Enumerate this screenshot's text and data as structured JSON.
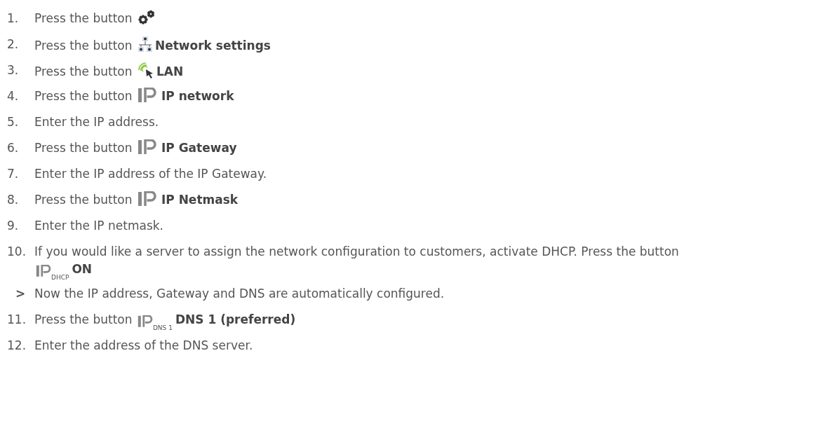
{
  "steps": [
    {
      "kind": "press",
      "number": "1.",
      "text": "Press the button"
    },
    {
      "kind": "press",
      "number": "2.",
      "text": "Press the button",
      "label": "Network settings"
    },
    {
      "kind": "press",
      "number": "3.",
      "text": "Press the button",
      "label": "LAN"
    },
    {
      "kind": "press",
      "number": "4.",
      "text": "Press the button",
      "label": "IP network"
    },
    {
      "kind": "text",
      "number": "5.",
      "text": "Enter the IP address."
    },
    {
      "kind": "press",
      "number": "6.",
      "text": "Press the button",
      "label": "IP Gateway"
    },
    {
      "kind": "text",
      "number": "7.",
      "text": "Enter the IP address of the IP Gateway."
    },
    {
      "kind": "press",
      "number": "8.",
      "text": "Press the button",
      "label": "IP Netmask"
    },
    {
      "kind": "text",
      "number": "9.",
      "text": "Enter the IP netmask."
    },
    {
      "kind": "press",
      "number": "10.",
      "text": "If you would like a server to assign the network configuration to customers, activate DHCP. Press the button",
      "icon_caption": "DHCP",
      "label": "ON"
    },
    {
      "kind": "result",
      "number": ">",
      "text": "Now the IP address, Gateway and DNS are automatically configured."
    },
    {
      "kind": "press",
      "number": "11.",
      "text": "Press the button",
      "icon_caption": "DNS 1",
      "label": "DNS 1 (preferred)"
    },
    {
      "kind": "text",
      "number": "12.",
      "text": "Enter the address of the DNS server."
    }
  ]
}
